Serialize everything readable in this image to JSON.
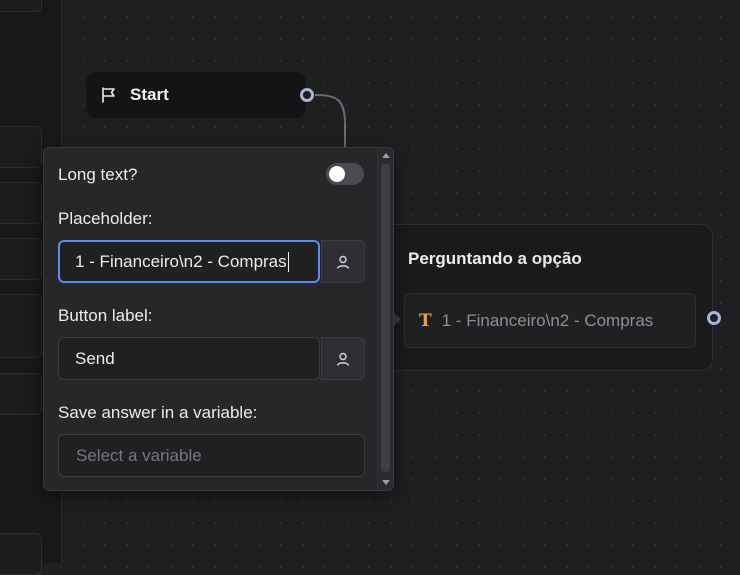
{
  "start_node": {
    "label": "Start",
    "icon": "flag-icon"
  },
  "group_node": {
    "title": "Perguntando a opção",
    "block": {
      "icon": "text-T-icon",
      "text": "1 - Financeiro\\n2 - Compras"
    }
  },
  "settings": {
    "long_text_label": "Long text?",
    "long_text_enabled": false,
    "placeholder_label": "Placeholder:",
    "placeholder_value": "1 - Financeiro\\n2 - Compras",
    "button_label_label": "Button label:",
    "button_label_value": "Send",
    "save_variable_label": "Save answer in a variable:",
    "variable_placeholder": "Select a variable"
  },
  "colors": {
    "canvas_bg": "#1f1f22",
    "accent_focus": "#5b8cf0",
    "endpoint_ring": "#a7b4d6",
    "text_icon": "#e8a04c"
  }
}
